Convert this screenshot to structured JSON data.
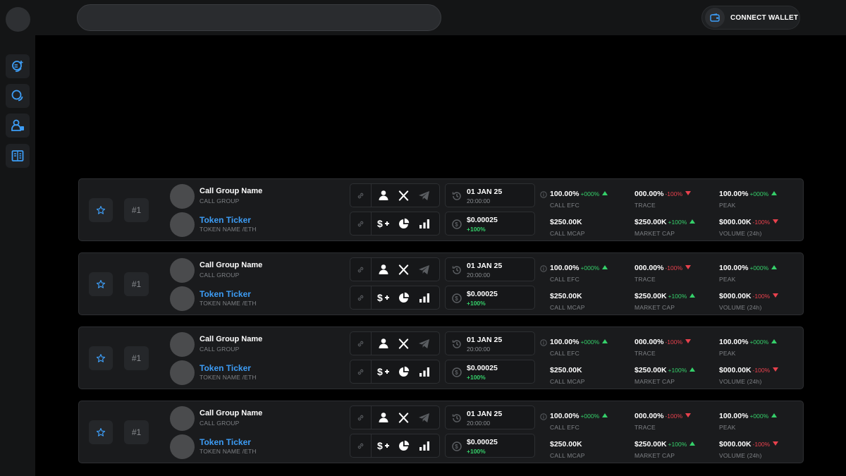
{
  "header": {
    "search_placeholder": "",
    "wallet_label": "CONNECT WALLET"
  },
  "sidebar": {
    "items": [
      {
        "icon": "coins-add-icon"
      },
      {
        "icon": "coins-icon"
      },
      {
        "icon": "user-group-icon"
      },
      {
        "icon": "document-icon"
      }
    ]
  },
  "colors": {
    "accent": "#3d9df6",
    "positive": "#35d06a",
    "negative": "#e8414d"
  },
  "rows": [
    {
      "rank": "#1",
      "group_name": "Call Group Name",
      "group_label": "CALL GROUP",
      "ticker": "Token Ticker",
      "token_label": "TOKEN NAME /ETH",
      "date": "01 JAN 25",
      "time": "20:00:00",
      "price": "$0.00025",
      "price_change": "+100%",
      "call_efc": "100.00%",
      "call_efc_change": "+000%",
      "call_efc_label": "CALL EFC",
      "trace": "000.00%",
      "trace_change": "-100%",
      "trace_label": "TRACE",
      "peak": "100.00%",
      "peak_change": "+000%",
      "peak_label": "PEAK",
      "call_mcap": "$250.00K",
      "call_mcap_label": "CALL MCAP",
      "market_cap": "$250.00K",
      "market_cap_change": "+100%",
      "market_cap_label": "MARKET CAP",
      "volume": "$000.00K",
      "volume_change": "-100%",
      "volume_label": "VOLUME (24h)"
    },
    {
      "rank": "#1",
      "group_name": "Call Group Name",
      "group_label": "CALL GROUP",
      "ticker": "Token Ticker",
      "token_label": "TOKEN NAME /ETH",
      "date": "01 JAN 25",
      "time": "20:00:00",
      "price": "$0.00025",
      "price_change": "+100%",
      "call_efc": "100.00%",
      "call_efc_change": "+000%",
      "call_efc_label": "CALL EFC",
      "trace": "000.00%",
      "trace_change": "-100%",
      "trace_label": "TRACE",
      "peak": "100.00%",
      "peak_change": "+000%",
      "peak_label": "PEAK",
      "call_mcap": "$250.00K",
      "call_mcap_label": "CALL MCAP",
      "market_cap": "$250.00K",
      "market_cap_change": "+100%",
      "market_cap_label": "MARKET CAP",
      "volume": "$000.00K",
      "volume_change": "-100%",
      "volume_label": "VOLUME (24h)"
    },
    {
      "rank": "#1",
      "group_name": "Call Group Name",
      "group_label": "CALL GROUP",
      "ticker": "Token Ticker",
      "token_label": "TOKEN NAME /ETH",
      "date": "01 JAN 25",
      "time": "20:00:00",
      "price": "$0.00025",
      "price_change": "+100%",
      "call_efc": "100.00%",
      "call_efc_change": "+000%",
      "call_efc_label": "CALL EFC",
      "trace": "000.00%",
      "trace_change": "-100%",
      "trace_label": "TRACE",
      "peak": "100.00%",
      "peak_change": "+000%",
      "peak_label": "PEAK",
      "call_mcap": "$250.00K",
      "call_mcap_label": "CALL MCAP",
      "market_cap": "$250.00K",
      "market_cap_change": "+100%",
      "market_cap_label": "MARKET CAP",
      "volume": "$000.00K",
      "volume_change": "-100%",
      "volume_label": "VOLUME (24h)"
    },
    {
      "rank": "#1",
      "group_name": "Call Group Name",
      "group_label": "CALL GROUP",
      "ticker": "Token Ticker",
      "token_label": "TOKEN NAME /ETH",
      "date": "01 JAN 25",
      "time": "20:00:00",
      "price": "$0.00025",
      "price_change": "+100%",
      "call_efc": "100.00%",
      "call_efc_change": "+000%",
      "call_efc_label": "CALL EFC",
      "trace": "000.00%",
      "trace_change": "-100%",
      "trace_label": "TRACE",
      "peak": "100.00%",
      "peak_change": "+000%",
      "peak_label": "PEAK",
      "call_mcap": "$250.00K",
      "call_mcap_label": "CALL MCAP",
      "market_cap": "$250.00K",
      "market_cap_change": "+100%",
      "market_cap_label": "MARKET CAP",
      "volume": "$000.00K",
      "volume_change": "-100%",
      "volume_label": "VOLUME (24h)"
    }
  ]
}
